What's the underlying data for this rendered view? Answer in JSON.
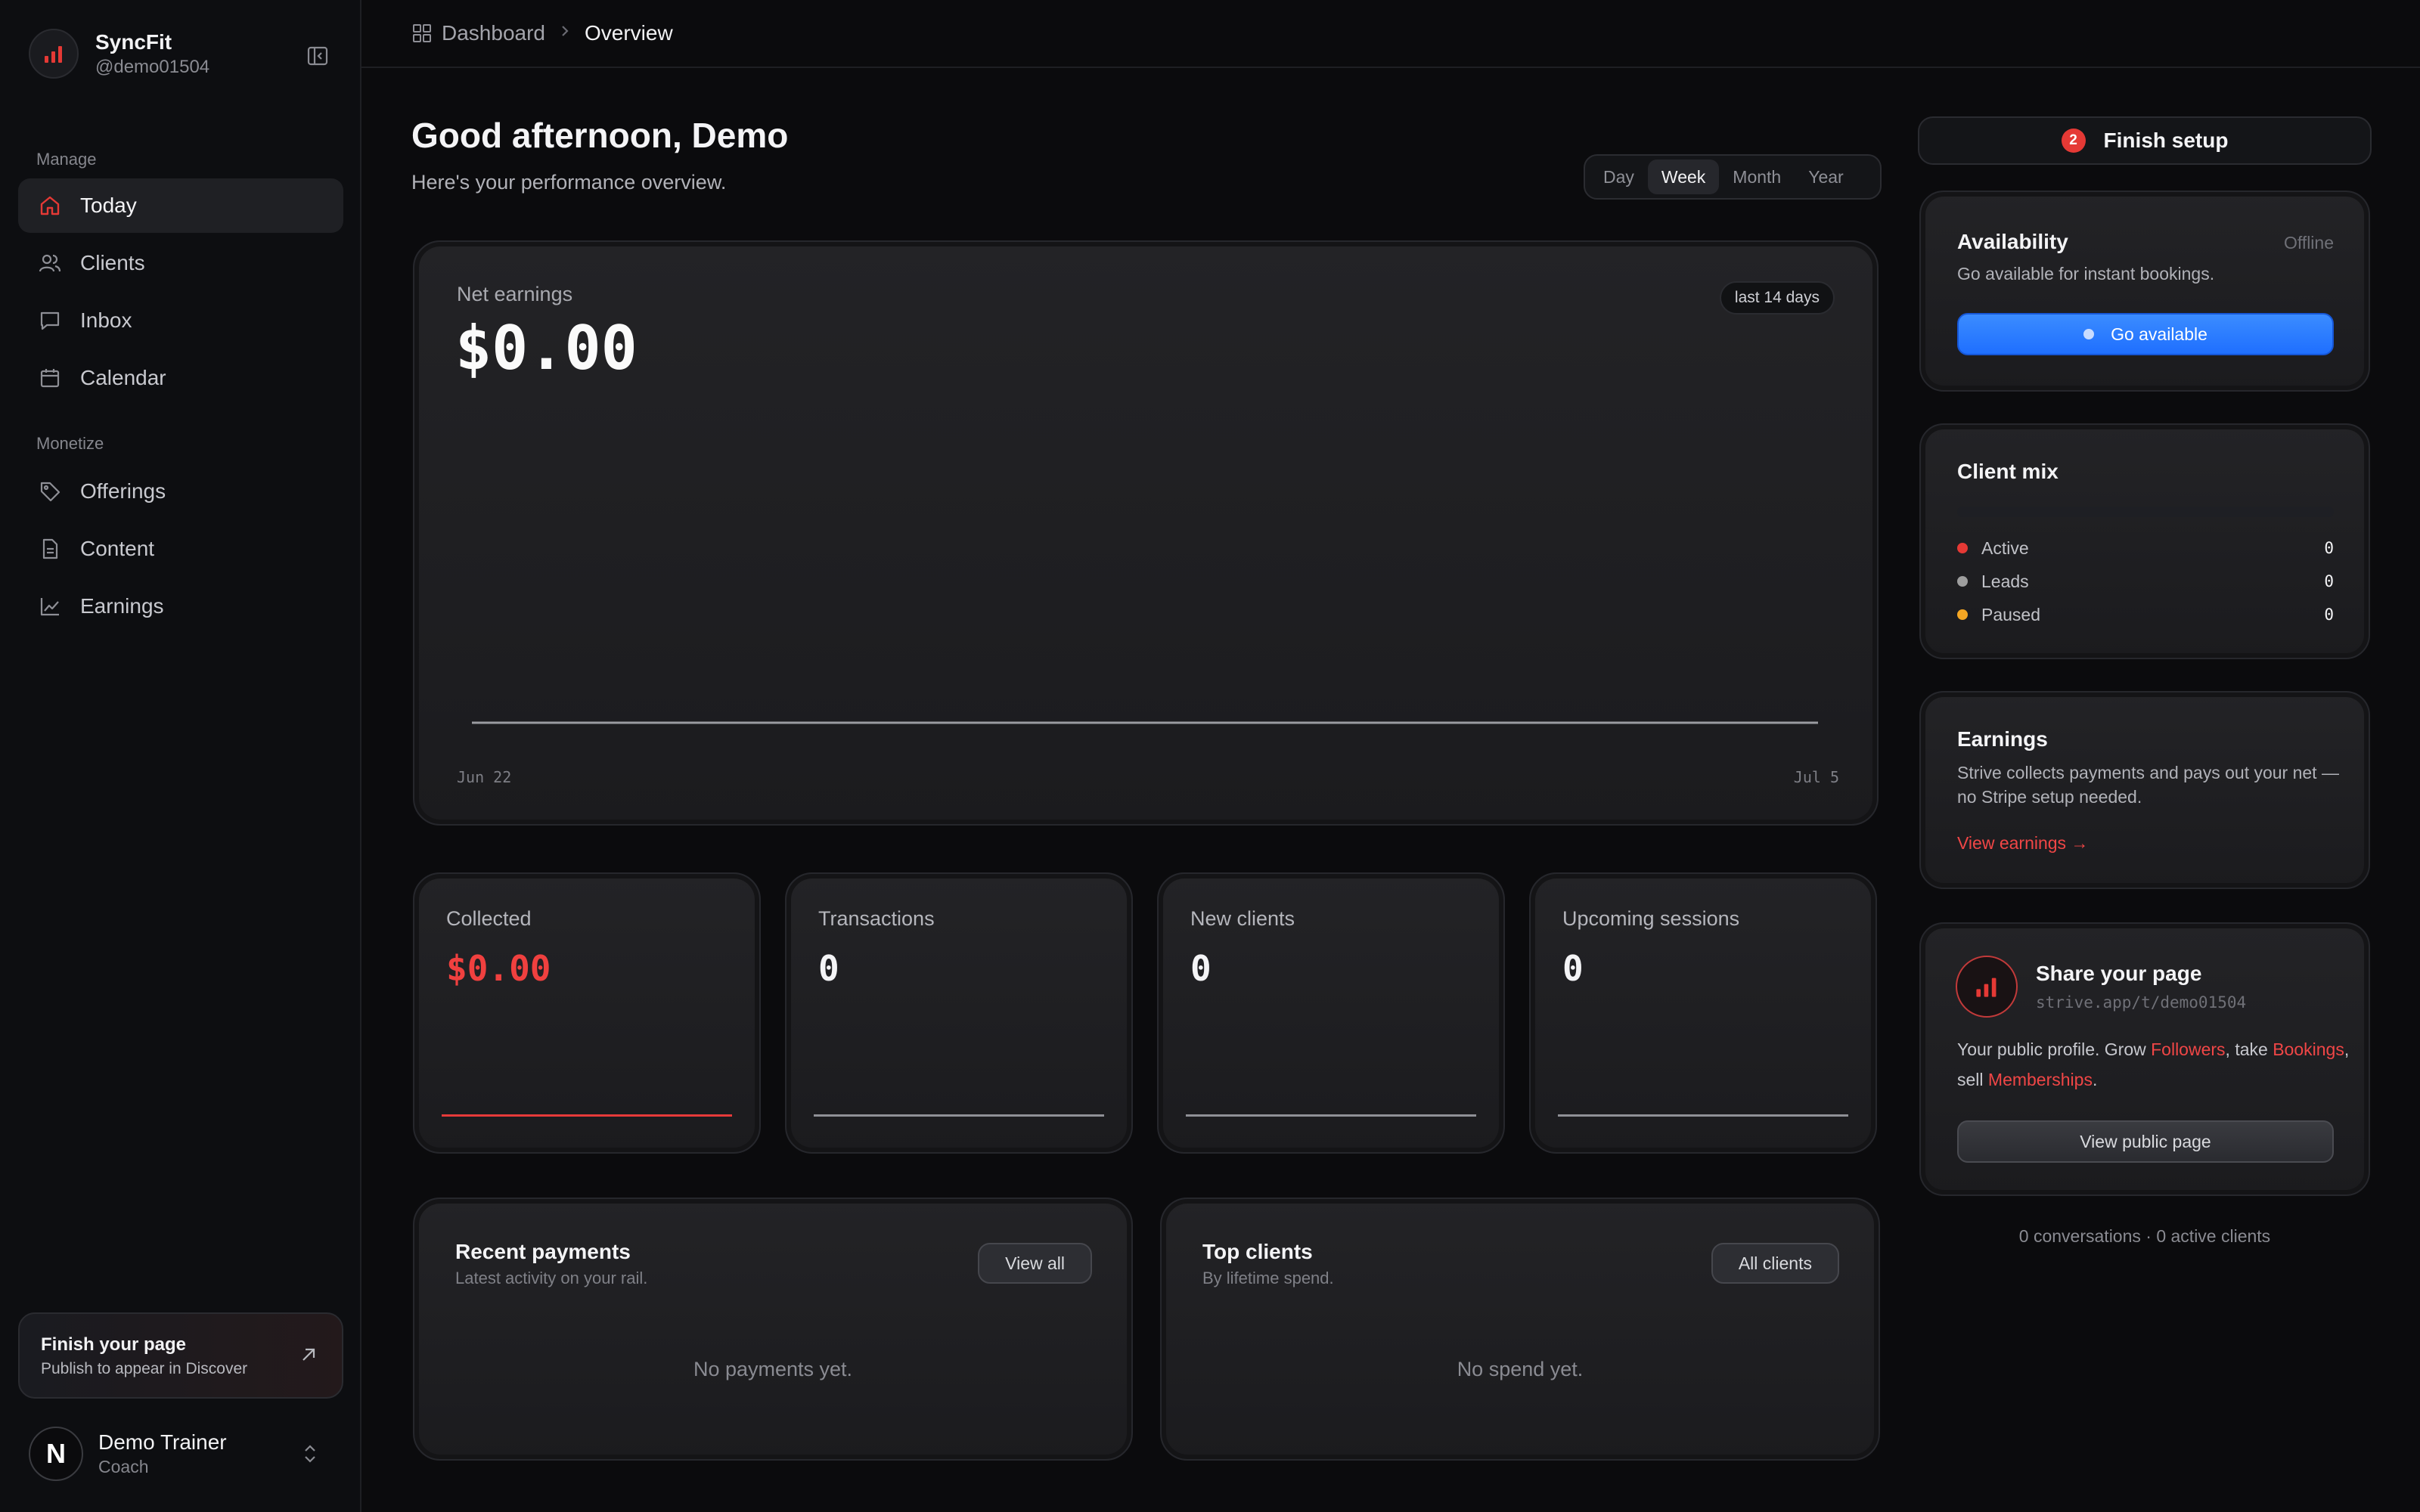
{
  "brand": {
    "name": "SyncFit",
    "handle": "@demo01504"
  },
  "sidebar": {
    "sections": [
      {
        "label": "Manage"
      },
      {
        "label": "Monetize"
      }
    ],
    "items": [
      {
        "label": "Today",
        "icon": "home-icon",
        "active": true
      },
      {
        "label": "Clients",
        "icon": "users-icon"
      },
      {
        "label": "Inbox",
        "icon": "chat-icon"
      },
      {
        "label": "Calendar",
        "icon": "calendar-icon"
      },
      {
        "label": "Offerings",
        "icon": "tag-icon"
      },
      {
        "label": "Content",
        "icon": "document-icon"
      },
      {
        "label": "Earnings",
        "icon": "chart-icon"
      }
    ],
    "finish": {
      "title": "Finish your page",
      "subtitle": "Publish to appear in Discover"
    },
    "user": {
      "initial": "N",
      "name": "Demo Trainer",
      "role": "Coach"
    }
  },
  "breadcrumb": {
    "parent": "Dashboard",
    "current": "Overview"
  },
  "header": {
    "greeting": "Good afternoon, Demo",
    "subtitle": "Here's your performance overview.",
    "ranges": [
      "Day",
      "Week",
      "Month",
      "Year"
    ],
    "selected_range": "Week"
  },
  "earnings_card": {
    "label": "Net earnings",
    "value": "$0.00",
    "badge": "last 14 days",
    "x_start": "Jun 22",
    "x_end": "Jul 5"
  },
  "chart_data": {
    "type": "line",
    "x": [
      "Jun 22",
      "Jul 5"
    ],
    "series": [
      {
        "values": [
          0,
          0
        ]
      }
    ],
    "xlabel": "",
    "ylabel": "",
    "title": ""
  },
  "stats": [
    {
      "label": "Collected",
      "value": "$0.00",
      "accent": true
    },
    {
      "label": "Transactions",
      "value": "0"
    },
    {
      "label": "New clients",
      "value": "0"
    },
    {
      "label": "Upcoming sessions",
      "value": "0"
    }
  ],
  "recent_payments": {
    "title": "Recent payments",
    "subtitle": "Latest activity on your rail.",
    "button": "View all",
    "empty": "No payments yet."
  },
  "top_clients": {
    "title": "Top clients",
    "subtitle": "By lifetime spend.",
    "button": "All clients",
    "empty": "No spend yet."
  },
  "setup": {
    "count": "2",
    "label": "Finish setup"
  },
  "availability": {
    "title": "Availability",
    "status": "Offline",
    "text": "Go available for instant bookings.",
    "button": "Go available"
  },
  "client_mix": {
    "title": "Client mix",
    "rows": [
      {
        "label": "Active",
        "value": "0",
        "color": "#e53935"
      },
      {
        "label": "Leads",
        "value": "0",
        "color": "#9e9e9e"
      },
      {
        "label": "Paused",
        "value": "0",
        "color": "#f5a623"
      }
    ]
  },
  "earnings_info": {
    "title": "Earnings",
    "text": "Strive collects payments and pays out your net — no Stripe setup needed.",
    "link": "View earnings →"
  },
  "share": {
    "title": "Share your page",
    "url": "strive.app/t/demo01504",
    "text_1": "Your public profile. Grow ",
    "followers": "Followers",
    "text_2": ", take ",
    "bookings": "Bookings",
    "text_3": ", sell ",
    "memberships": "Memberships",
    "text_4": ".",
    "button": "View public page"
  },
  "footer": "0 conversations · 0 active clients",
  "colors": {
    "accent": "#e53935",
    "blue": "#1f6fff",
    "background": "#0b0b0d"
  }
}
